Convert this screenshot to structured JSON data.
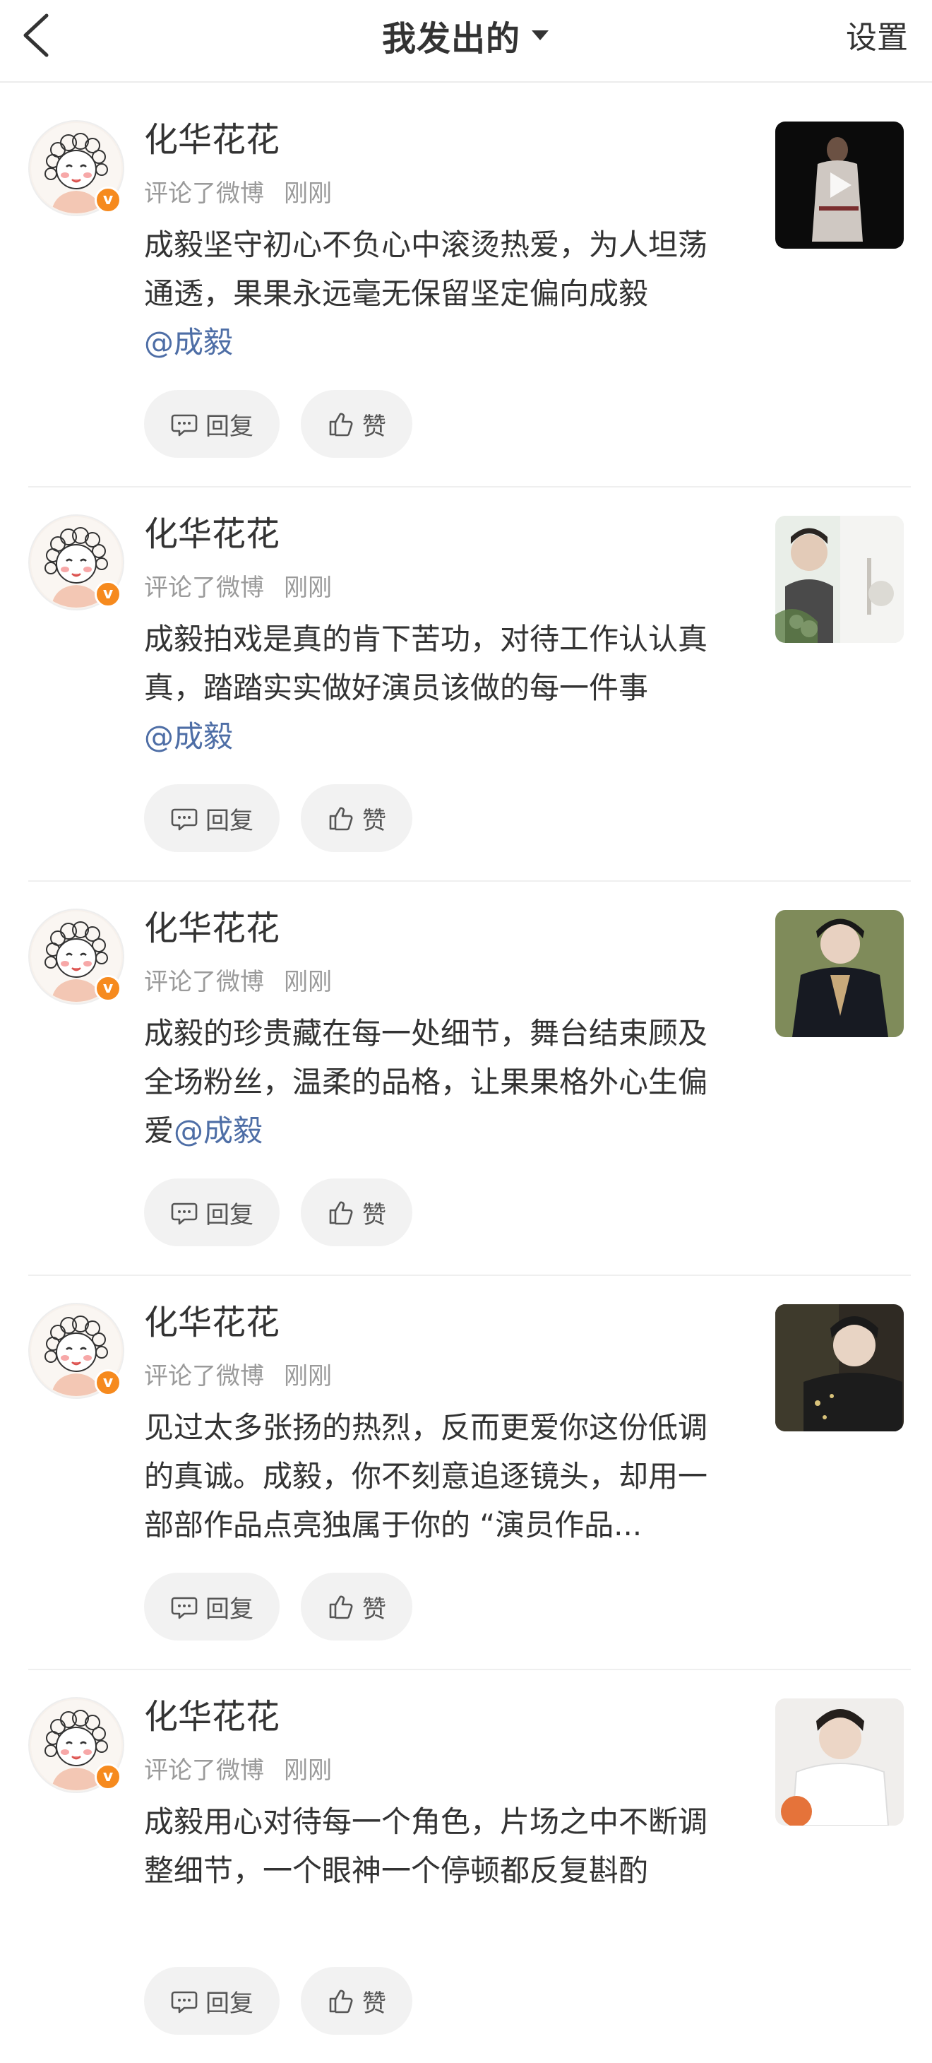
{
  "header": {
    "title": "我发出的",
    "settings_label": "设置",
    "back_icon": "chevron-left-icon",
    "caret_icon": "caret-down-icon"
  },
  "colors": {
    "link": "#4e6ea6",
    "verified_badge": "#f68a1e",
    "meta_text": "#9a9a9a",
    "pill_background": "#f2f2f2"
  },
  "feed": {
    "items": [
      {
        "username": "化华花花",
        "action": "评论了微博",
        "time": "刚刚",
        "text": "成毅坚守初心不负心中滚烫热爱，为人坦荡通透，果果永远毫无保留坚定偏向成毅",
        "mention": "@成毅",
        "mention_newline": true,
        "reply_label": "回复",
        "like_label": "赞",
        "thumbnail": "video-thumbnail"
      },
      {
        "username": "化华花花",
        "action": "评论了微博",
        "time": "刚刚",
        "text": "成毅拍戏是真的肯下苦功，对待工作认认真真，踏踏实实做好演员该做的每一件事",
        "mention": "@成毅",
        "mention_newline": true,
        "reply_label": "回复",
        "like_label": "赞",
        "thumbnail": "photo-thumbnail"
      },
      {
        "username": "化华花花",
        "action": "评论了微博",
        "time": "刚刚",
        "text": "成毅的珍贵藏在每一处细节，舞台结束顾及全场粉丝，温柔的品格，让果果格外心生偏爱",
        "mention": "@成毅",
        "mention_newline": false,
        "reply_label": "回复",
        "like_label": "赞",
        "thumbnail": "photo-thumbnail"
      },
      {
        "username": "化华花花",
        "action": "评论了微博",
        "time": "刚刚",
        "text": "见过太多张扬的热烈，反而更爱你这份低调的真诚。成毅，你不刻意追逐镜头，却用一部部作品点亮独属于你的 “演员作品...",
        "mention": "",
        "mention_newline": false,
        "reply_label": "回复",
        "like_label": "赞",
        "thumbnail": "photo-thumbnail"
      },
      {
        "username": "化华花花",
        "action": "评论了微博",
        "time": "刚刚",
        "text": "成毅用心对待每一个角色，片场之中不断调整细节，一个眼神一个停顿都反复斟酌",
        "mention": "",
        "mention_newline": false,
        "reply_label": "回复",
        "like_label": "赞",
        "thumbnail": "photo-thumbnail"
      }
    ]
  }
}
